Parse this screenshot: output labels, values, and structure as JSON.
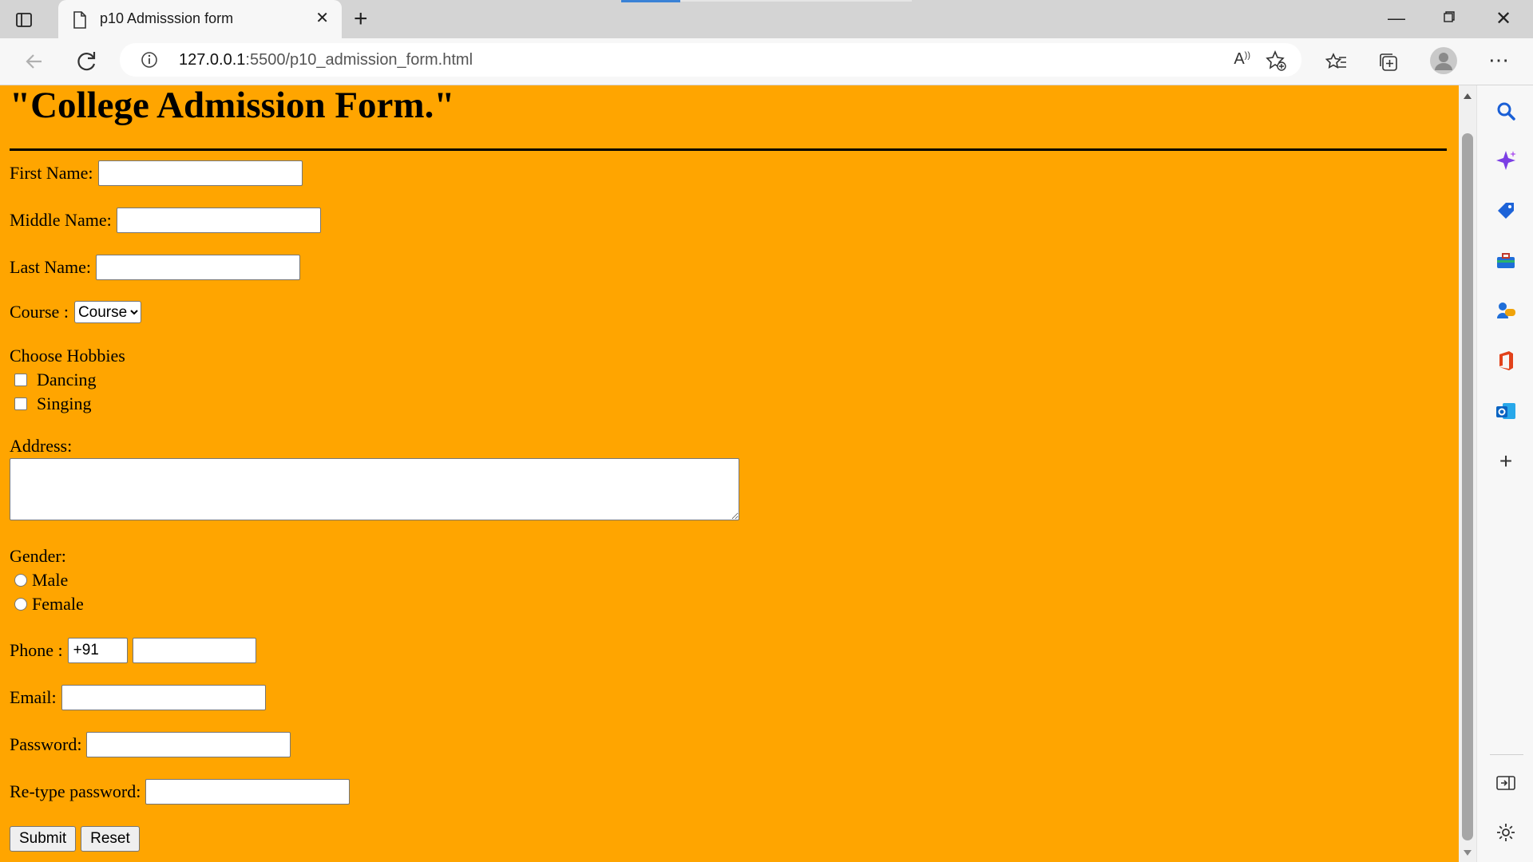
{
  "browser": {
    "tab_title": "p10 Admisssion form",
    "url_host": "127.0.0.1",
    "url_rest": ":5500/p10_admission_form.html",
    "accent_color": "#3a82d6"
  },
  "page": {
    "background_color": "#ffa500",
    "heading": "\"College Admission Form.\"",
    "first_name_label": "First Name:",
    "middle_name_label": "Middle Name:",
    "last_name_label": "Last Name:",
    "course_label": "Course :",
    "course_selected": "Course",
    "hobbies_label": "Choose Hobbies",
    "hobbies": [
      "Dancing",
      "Singing"
    ],
    "address_label": "Address:",
    "gender_label": "Gender:",
    "genders": [
      "Male",
      "Female"
    ],
    "phone_label": "Phone :",
    "phone_code": "+91",
    "email_label": "Email:",
    "password_label": "Password:",
    "retype_label": "Re-type password:",
    "submit_label": "Submit",
    "reset_label": "Reset"
  },
  "sidebar_icons": [
    "search-icon",
    "copilot-icon",
    "shopping-tag-icon",
    "tools-icon",
    "games-icon",
    "office-icon",
    "outlook-icon",
    "add-icon",
    "split-screen-icon",
    "settings-icon"
  ]
}
